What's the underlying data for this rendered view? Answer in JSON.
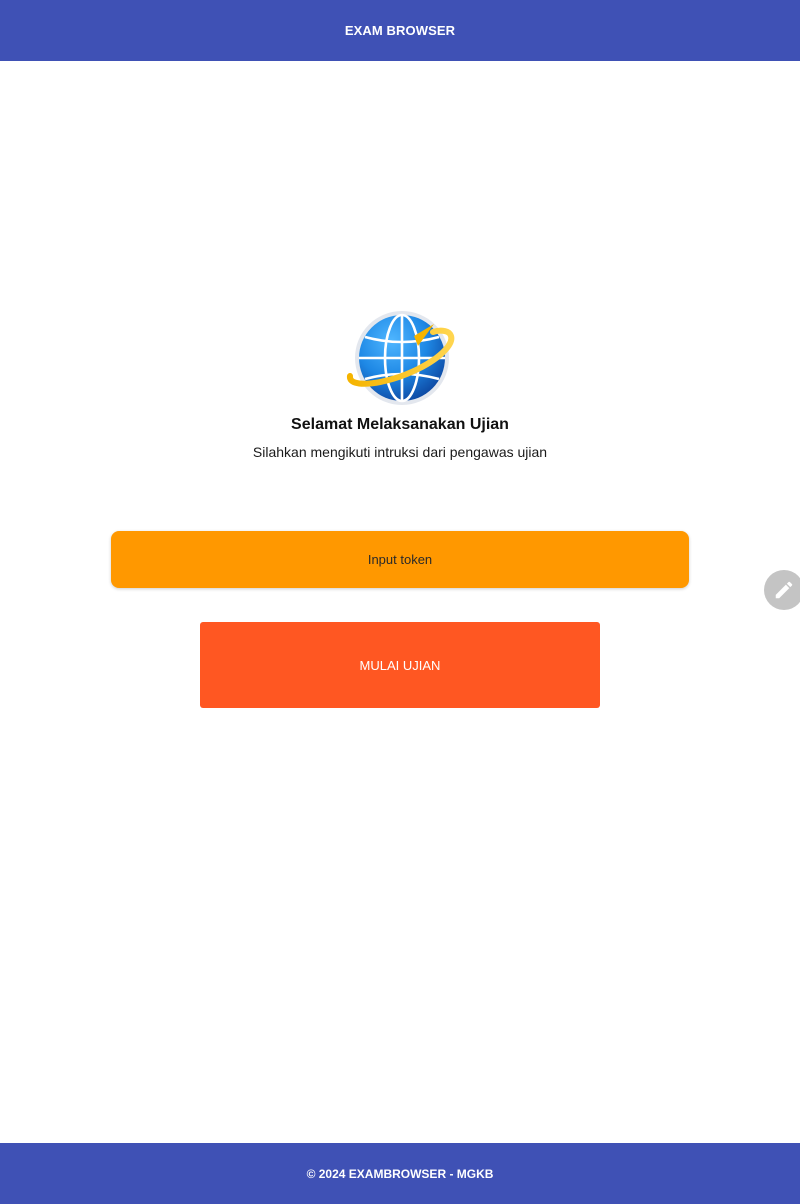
{
  "app_bar": {
    "title": "EXAM BROWSER"
  },
  "logo": {
    "icon": "globe-icon"
  },
  "welcome": {
    "title": "Selamat Melaksanakan Ujian",
    "subtitle": "Silahkan mengikuti intruksi dari pengawas ujian"
  },
  "actions": {
    "token_label": "Input token",
    "start_label": "MULAI UJIAN"
  },
  "floating": {
    "icon": "pencil-icon"
  },
  "footer": {
    "text": "© 2024 EXAMBROWSER - MGKB"
  },
  "colors": {
    "primary": "#3f51b5",
    "token_button": "#ff9800",
    "start_button": "#ff5722",
    "fab": "#c4c4c4"
  }
}
